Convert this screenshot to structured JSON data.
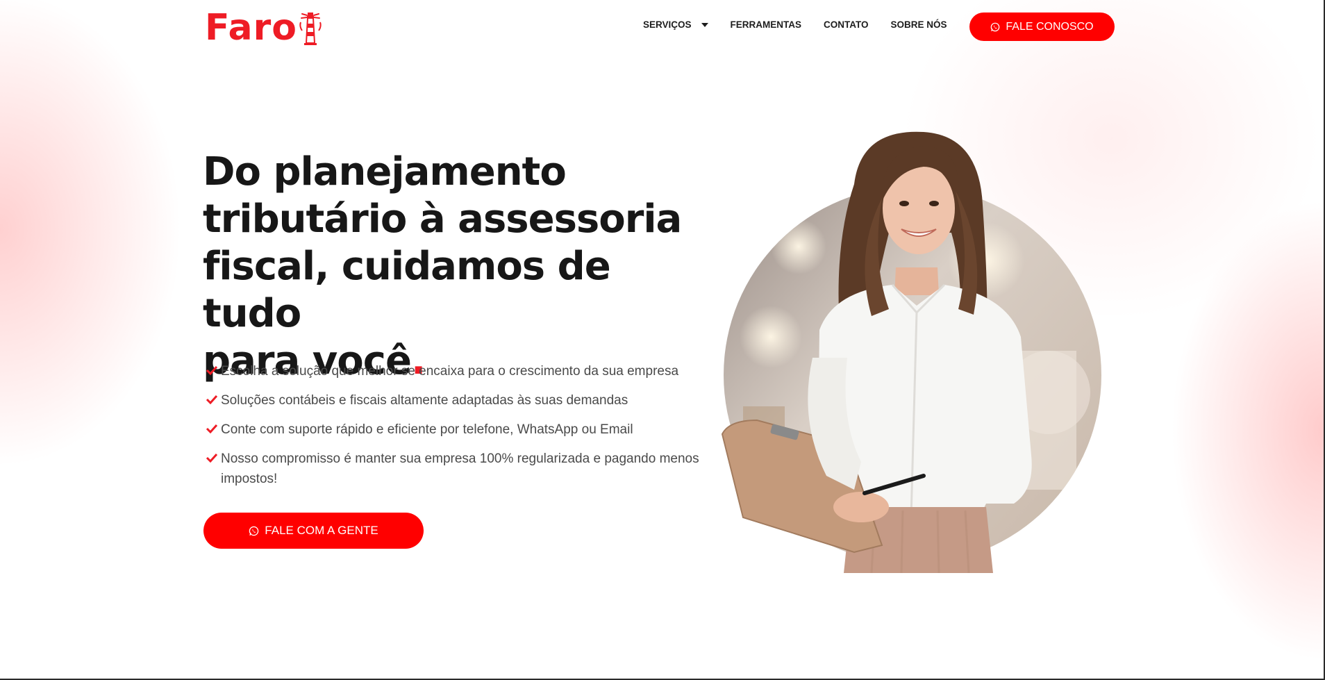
{
  "header": {
    "logo_text": "Faro",
    "nav": [
      {
        "label": "SERVIÇOS",
        "has_dropdown": true
      },
      {
        "label": "FERRAMENTAS"
      },
      {
        "label": "CONTATO"
      },
      {
        "label": "SOBRE NÓS"
      }
    ],
    "cta_label": "FALE CONOSCO"
  },
  "hero": {
    "title_line1": "Do planejamento",
    "title_line2": "tributário à assessoria",
    "title_line3": "fiscal, cuidamos de tudo",
    "title_line4": "para você",
    "title_dot": ".",
    "bullets": [
      "Escolha a solução que melhor se encaixa para o crescimento da sua empresa",
      "Soluções contábeis e fiscais altamente adaptadas às suas demandas",
      "Conte com suporte rápido e eficiente por telefone, WhatsApp ou Email",
      "Nosso compromisso é manter sua empresa 100% regularizada e pagando menos impostos!"
    ],
    "cta_label": "FALE COM A GENTE"
  },
  "colors": {
    "brand_red": "#ee1c25",
    "button_red": "#ff0000",
    "text_dark": "#171717",
    "text_muted": "#4a4a4a"
  },
  "icons": {
    "logo": "lighthouse-icon",
    "cta": "whatsapp-icon",
    "bullet": "check-icon",
    "dropdown": "caret-down-icon"
  }
}
